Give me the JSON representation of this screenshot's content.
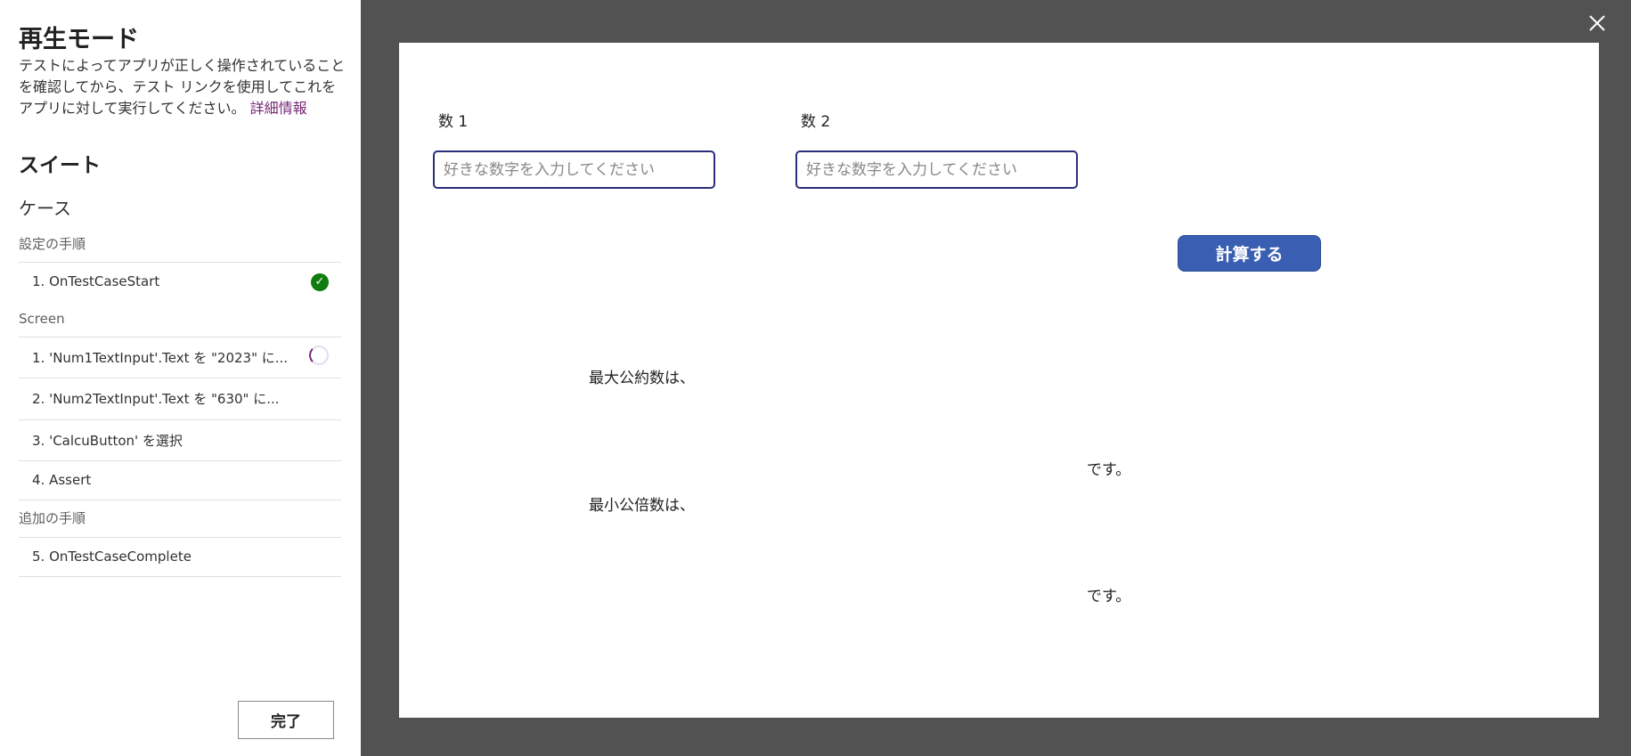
{
  "panel": {
    "title": "再生モード",
    "description": "テストによってアプリが正しく操作されていることを確認してから、テスト リンクを使用してこれをアプリに対して実行してください。 ",
    "more_link": "詳細情報",
    "suite_label": "スイート",
    "case_label": "ケース",
    "setup_section": "設定の手順",
    "setup_steps": [
      {
        "label": "1.  OnTestCaseStart",
        "status": "success"
      }
    ],
    "screen_section": "Screen",
    "screen_steps": [
      {
        "label": "1.  'Num1TextInput'.Text を \"2023\" に...",
        "status": "running"
      },
      {
        "label": "2.  'Num2TextInput'.Text を \"630\" に...",
        "status": "pending"
      },
      {
        "label": "3.  'CalcuButton' を選択",
        "status": "pending"
      },
      {
        "label": "4.  Assert",
        "status": "pending"
      }
    ],
    "additional_section": "追加の手順",
    "additional_steps": [
      {
        "label": "5.  OnTestCaseComplete",
        "status": "pending"
      }
    ],
    "done_button": "完了"
  },
  "app": {
    "num1_label": "数 1",
    "num2_label": "数 2",
    "num1_placeholder": "好きな数字を入力してください",
    "num1_value": "",
    "num2_placeholder": "好きな数字を入力してください",
    "num2_value": "",
    "calc_button": "計算する",
    "gcd_label": "最大公約数は、",
    "gcd_suffix": "です。",
    "lcm_label": "最小公倍数は、",
    "lcm_suffix": "です。"
  },
  "icons": {
    "close": "close-icon",
    "success": "check-circle-icon",
    "running": "spinner-icon"
  },
  "colors": {
    "accent": "#742774",
    "success": "#107c10",
    "button": "#3a5fb2",
    "backdrop": "#525252"
  }
}
